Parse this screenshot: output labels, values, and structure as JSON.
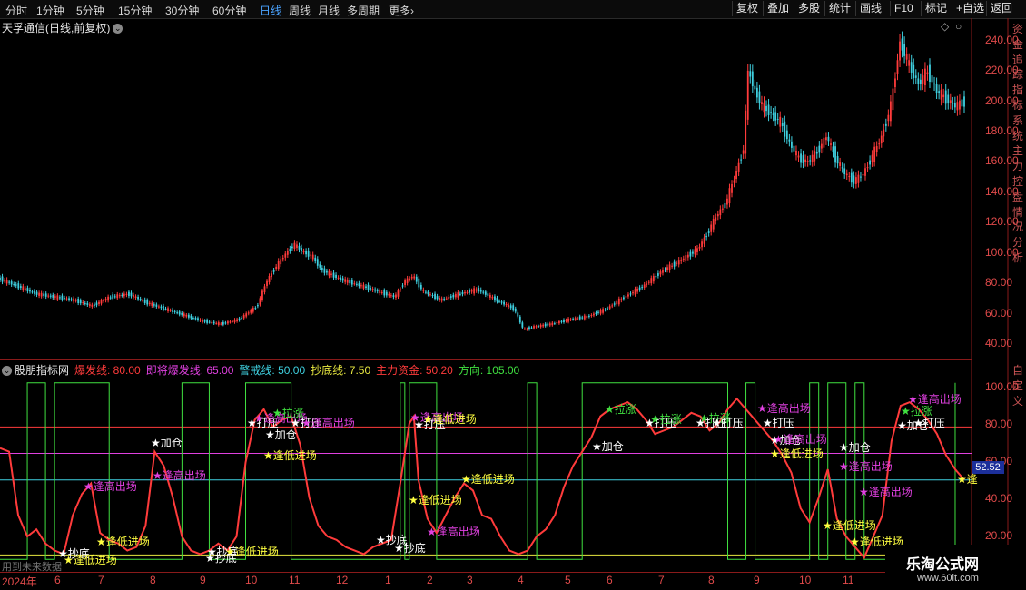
{
  "toolbar": {
    "timeframes": [
      "分时",
      "1分钟",
      "5分钟",
      "15分钟",
      "30分钟",
      "60分钟",
      "日线",
      "周线",
      "月线",
      "多周期",
      "更多"
    ],
    "active_timeframe": "日线",
    "more_arrow": "›",
    "right_buttons": [
      "复权",
      "叠加",
      "多股",
      "统计",
      "画线",
      "F10",
      "标记",
      "+自选",
      "返回"
    ]
  },
  "main_chart": {
    "title": "天孚通信(日线,前复权)",
    "title_icon": "chevron-down-icon",
    "corner_icons": [
      "◇",
      "○"
    ],
    "y_ticks": [
      "240.00",
      "220.00",
      "200.00",
      "180.00",
      "160.00",
      "140.00",
      "120.00",
      "100.00",
      "80.00",
      "60.00",
      "40.00"
    ],
    "right_column_text": "资金追踪指标系统主力控盘情况分析",
    "colors": {
      "up": "#ff3b3b",
      "down": "#3fd0e0"
    }
  },
  "indicator": {
    "name": "股朋指标网",
    "params": [
      {
        "label": "爆发线: 80.00",
        "color": "#ff3b3b"
      },
      {
        "label": "即将爆发线: 65.00",
        "color": "#e040e0"
      },
      {
        "label": "警戒线: 50.00",
        "color": "#3fd0e0"
      },
      {
        "label": "抄底线: 7.50",
        "color": "#e8e840"
      },
      {
        "label": "主力资金: 50.20",
        "color": "#ff3b3b"
      },
      {
        "label": "方向: 105.00",
        "color": "#40e040"
      }
    ],
    "y_ticks": [
      "100.00",
      "80.00",
      "60.00",
      "40.00",
      "20.00"
    ],
    "right_column_text": "自定义",
    "current_value": "52.52",
    "future_note": "用到未来数据",
    "signals": [
      {
        "text": "★抄底",
        "color": "#ffffff"
      },
      {
        "text": "★逢低进场",
        "color": "#ffff40"
      },
      {
        "text": "★逢低进场",
        "color": "#ffff40"
      },
      {
        "text": "★逢高出场",
        "color": "#e040e0"
      },
      {
        "text": "★加仓",
        "color": "#ffffff"
      },
      {
        "text": "★逢高出场",
        "color": "#e040e0"
      },
      {
        "text": "★抄底",
        "color": "#ffffff"
      },
      {
        "text": "★逢低进场",
        "color": "#ffff40"
      },
      {
        "text": "★抄底",
        "color": "#ffffff"
      },
      {
        "text": "★打压",
        "color": "#ffffff"
      },
      {
        "text": "★逢高出场",
        "color": "#e040e0"
      },
      {
        "text": "★拉涨",
        "color": "#40e040"
      },
      {
        "text": "★加仓",
        "color": "#ffffff"
      },
      {
        "text": "★逢低进场",
        "color": "#ffff40"
      },
      {
        "text": "★打压",
        "color": "#ffffff"
      },
      {
        "text": "★逢高出场",
        "color": "#e040e0"
      },
      {
        "text": "★抄底",
        "color": "#ffffff"
      },
      {
        "text": "★抄底",
        "color": "#ffffff"
      },
      {
        "text": "★逢低进场",
        "color": "#ffff40"
      },
      {
        "text": "★逢高出场",
        "color": "#e040e0"
      },
      {
        "text": "★打压",
        "color": "#ffffff"
      },
      {
        "text": "★逢低进场",
        "color": "#ffff40"
      },
      {
        "text": "★逢高出场",
        "color": "#e040e0"
      },
      {
        "text": "★逢低进场",
        "color": "#ffff40"
      },
      {
        "text": "★加仓",
        "color": "#ffffff"
      },
      {
        "text": "★拉涨",
        "color": "#40e040"
      },
      {
        "text": "★打压",
        "color": "#ffffff"
      },
      {
        "text": "★拉涨",
        "color": "#40e040"
      },
      {
        "text": "★打压",
        "color": "#ffffff"
      },
      {
        "text": "★拉涨",
        "color": "#40e040"
      },
      {
        "text": "★打压",
        "color": "#ffffff"
      },
      {
        "text": "★逢高出场",
        "color": "#e040e0"
      },
      {
        "text": "★打压",
        "color": "#ffffff"
      },
      {
        "text": "★加仓",
        "color": "#ffffff"
      },
      {
        "text": "★逢低进场",
        "color": "#ffff40"
      },
      {
        "text": "★逢高出场",
        "color": "#e040e0"
      },
      {
        "text": "★加仓",
        "color": "#ffffff"
      },
      {
        "text": "★逢高出场",
        "color": "#e040e0"
      },
      {
        "text": "★逢低进场",
        "color": "#ffff40"
      },
      {
        "text": "★逢高出场",
        "color": "#e040e0"
      },
      {
        "text": "★逢低进场",
        "color": "#ffff40"
      },
      {
        "text": "★加仓",
        "color": "#ffffff"
      },
      {
        "text": "★打压",
        "color": "#ffffff"
      },
      {
        "text": "★逢高出场",
        "color": "#e040e0"
      },
      {
        "text": "★拉涨",
        "color": "#40e040"
      },
      {
        "text": "★逢",
        "color": "#ffff40"
      }
    ]
  },
  "date_axis": {
    "labels": [
      "2024年",
      "6",
      "7",
      "8",
      "9",
      "10",
      "11",
      "12",
      "1",
      "2",
      "3",
      "4",
      "5",
      "6",
      "7",
      "8",
      "9",
      "10",
      "11"
    ]
  },
  "watermark": {
    "line1": "乐淘公式网",
    "line2": "www.60lt.com"
  },
  "chart_data": [
    {
      "type": "candlestick",
      "title": "天孚通信(日线,前复权)",
      "ylim": [
        30,
        250
      ],
      "y_ticks": [
        40,
        60,
        80,
        100,
        120,
        140,
        160,
        180,
        200,
        220,
        240
      ],
      "close_path": [
        [
          0,
          80
        ],
        [
          4,
          75
        ],
        [
          8,
          70
        ],
        [
          12,
          68
        ],
        [
          16,
          66
        ],
        [
          20,
          62
        ],
        [
          24,
          68
        ],
        [
          28,
          70
        ],
        [
          32,
          64
        ],
        [
          36,
          60
        ],
        [
          40,
          56
        ],
        [
          44,
          52
        ],
        [
          48,
          50
        ],
        [
          52,
          53
        ],
        [
          56,
          62
        ],
        [
          58,
          78
        ],
        [
          60,
          88
        ],
        [
          62,
          96
        ],
        [
          64,
          103
        ],
        [
          66,
          98
        ],
        [
          68,
          95
        ],
        [
          70,
          86
        ],
        [
          74,
          80
        ],
        [
          78,
          76
        ],
        [
          82,
          72
        ],
        [
          86,
          68
        ],
        [
          88,
          78
        ],
        [
          90,
          82
        ],
        [
          92,
          72
        ],
        [
          96,
          66
        ],
        [
          100,
          70
        ],
        [
          104,
          73
        ],
        [
          108,
          66
        ],
        [
          112,
          60
        ],
        [
          114,
          46
        ],
        [
          116,
          48
        ],
        [
          120,
          50
        ],
        [
          124,
          53
        ],
        [
          128,
          55
        ],
        [
          132,
          60
        ],
        [
          136,
          68
        ],
        [
          140,
          75
        ],
        [
          144,
          85
        ],
        [
          148,
          92
        ],
        [
          152,
          100
        ],
        [
          154,
          110
        ],
        [
          156,
          122
        ],
        [
          158,
          130
        ],
        [
          160,
          148
        ],
        [
          162,
          168
        ],
        [
          163,
          222
        ],
        [
          164,
          208
        ],
        [
          166,
          195
        ],
        [
          168,
          190
        ],
        [
          170,
          184
        ],
        [
          172,
          170
        ],
        [
          174,
          160
        ],
        [
          176,
          158
        ],
        [
          178,
          165
        ],
        [
          180,
          175
        ],
        [
          182,
          160
        ],
        [
          184,
          150
        ],
        [
          186,
          145
        ],
        [
          188,
          150
        ],
        [
          190,
          162
        ],
        [
          192,
          175
        ],
        [
          194,
          195
        ],
        [
          196,
          238
        ],
        [
          198,
          222
        ],
        [
          200,
          210
        ],
        [
          202,
          218
        ],
        [
          204,
          205
        ],
        [
          206,
          200
        ],
        [
          208,
          195
        ],
        [
          210,
          198
        ]
      ]
    },
    {
      "type": "line",
      "title": "股朋指标网",
      "ylim": [
        0,
        110
      ],
      "y_ticks": [
        20,
        40,
        60,
        80,
        100
      ],
      "reference_lines": [
        {
          "name": "爆发线",
          "value": 80,
          "color": "#ff3b3b"
        },
        {
          "name": "即将爆发线",
          "value": 65,
          "color": "#e040e0"
        },
        {
          "name": "警戒线",
          "value": 50,
          "color": "#3fd0e0"
        },
        {
          "name": "抄底线",
          "value": 7.5,
          "color": "#e8e840"
        }
      ],
      "series": [
        {
          "name": "主力资金",
          "color": "#ff3b3b",
          "points": [
            [
              0,
              68
            ],
            [
              2,
              66
            ],
            [
              4,
              30
            ],
            [
              6,
              18
            ],
            [
              8,
              22
            ],
            [
              10,
              14
            ],
            [
              12,
              10
            ],
            [
              14,
              8
            ],
            [
              16,
              30
            ],
            [
              18,
              42
            ],
            [
              20,
              48
            ],
            [
              22,
              20
            ],
            [
              24,
              16
            ],
            [
              26,
              14
            ],
            [
              28,
              10
            ],
            [
              30,
              12
            ],
            [
              32,
              24
            ],
            [
              34,
              66
            ],
            [
              36,
              58
            ],
            [
              38,
              40
            ],
            [
              40,
              18
            ],
            [
              42,
              10
            ],
            [
              44,
              8
            ],
            [
              46,
              10
            ],
            [
              48,
              14
            ],
            [
              50,
              10
            ],
            [
              52,
              18
            ],
            [
              54,
              60
            ],
            [
              56,
              84
            ],
            [
              58,
              90
            ],
            [
              60,
              80
            ],
            [
              62,
              84
            ],
            [
              64,
              86
            ],
            [
              66,
              70
            ],
            [
              68,
              40
            ],
            [
              70,
              24
            ],
            [
              72,
              18
            ],
            [
              74,
              16
            ],
            [
              76,
              12
            ],
            [
              78,
              10
            ],
            [
              80,
              8
            ],
            [
              82,
              12
            ],
            [
              84,
              14
            ],
            [
              86,
              16
            ],
            [
              88,
              48
            ],
            [
              90,
              82
            ],
            [
              91,
              86
            ],
            [
              92,
              50
            ],
            [
              94,
              28
            ],
            [
              96,
              20
            ],
            [
              98,
              30
            ],
            [
              100,
              40
            ],
            [
              102,
              48
            ],
            [
              104,
              44
            ],
            [
              106,
              30
            ],
            [
              108,
              28
            ],
            [
              110,
              18
            ],
            [
              112,
              10
            ],
            [
              114,
              8
            ],
            [
              116,
              10
            ],
            [
              118,
              18
            ],
            [
              120,
              22
            ],
            [
              122,
              30
            ],
            [
              124,
              46
            ],
            [
              126,
              58
            ],
            [
              128,
              66
            ],
            [
              130,
              74
            ],
            [
              132,
              86
            ],
            [
              134,
              90
            ],
            [
              136,
              92
            ],
            [
              138,
              94
            ],
            [
              140,
              90
            ],
            [
              142,
              84
            ],
            [
              144,
              76
            ],
            [
              146,
              78
            ],
            [
              148,
              80
            ],
            [
              150,
              84
            ],
            [
              152,
              88
            ],
            [
              154,
              86
            ],
            [
              156,
              78
            ],
            [
              158,
              82
            ],
            [
              160,
              90
            ],
            [
              162,
              96
            ],
            [
              164,
              90
            ],
            [
              166,
              84
            ],
            [
              168,
              78
            ],
            [
              170,
              72
            ],
            [
              172,
              64
            ],
            [
              174,
              54
            ],
            [
              176,
              34
            ],
            [
              178,
              26
            ],
            [
              180,
              40
            ],
            [
              182,
              56
            ],
            [
              184,
              28
            ],
            [
              186,
              18
            ],
            [
              188,
              12
            ],
            [
              190,
              6
            ],
            [
              192,
              18
            ],
            [
              194,
              30
            ],
            [
              196,
              72
            ],
            [
              198,
              92
            ],
            [
              200,
              94
            ],
            [
              202,
              90
            ],
            [
              204,
              84
            ],
            [
              206,
              76
            ],
            [
              208,
              64
            ],
            [
              210,
              56
            ],
            [
              212,
              50
            ]
          ]
        },
        {
          "name": "方向",
          "color": "#40e040",
          "steps": [
            [
              0,
              5
            ],
            [
              6,
              105
            ],
            [
              10,
              5
            ],
            [
              12,
              105
            ],
            [
              24,
              5
            ],
            [
              40,
              105
            ],
            [
              46,
              5
            ],
            [
              54,
              105
            ],
            [
              64,
              5
            ],
            [
              88,
              105
            ],
            [
              89,
              5
            ],
            [
              90,
              105
            ],
            [
              96,
              5
            ],
            [
              116,
              105
            ],
            [
              118,
              5
            ],
            [
              128,
              105
            ],
            [
              160,
              5
            ],
            [
              164,
              105
            ],
            [
              166,
              5
            ],
            [
              178,
              105
            ],
            [
              180,
              5
            ],
            [
              182,
              105
            ],
            [
              186,
              5
            ],
            [
              188,
              105
            ],
            [
              190,
              5
            ],
            [
              210,
              105
            ]
          ]
        }
      ]
    }
  ]
}
